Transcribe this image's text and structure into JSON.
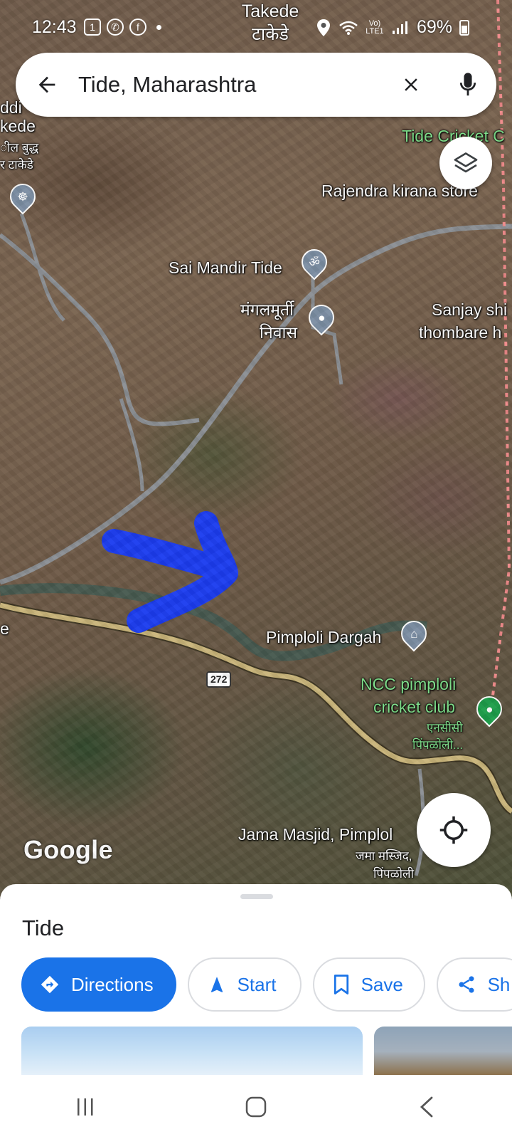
{
  "status_bar": {
    "time": "12:43",
    "notification_icons": [
      "calendar-icon",
      "whatsapp-icon",
      "facebook-icon",
      "more-dot-icon"
    ],
    "network_label": "Vo) LTE1",
    "battery_percent": "69%"
  },
  "search": {
    "query": "Tide, Maharashtra"
  },
  "map": {
    "labels": {
      "takede_en": "Takede",
      "takede_mr": "टाकेडे",
      "left_edge_1": "ddi",
      "left_edge_2": "kede",
      "left_edge_3": "ील बुद्ध",
      "left_edge_4": "र टाकेडे",
      "tide_cricket": "Tide Cricket C",
      "rajendra": "Rajendra kirana store",
      "sai_mandir": "Sai Mandir Tide",
      "mangalmurti_1": "मंगलमूर्ती",
      "mangalmurti_2": "निवास",
      "sanjay_1": "Sanjay shi",
      "sanjay_2": "thombare h",
      "left_edge_e": "e",
      "pimploli_dargah": "Pimploli Dargah",
      "road_number": "272",
      "ncc_1": "NCC pimploli",
      "ncc_2": "cricket club",
      "ncc_mr_1": "एनसीसी",
      "ncc_mr_2": "पिंपळोली...",
      "jama_masjid": "Jama Masjid, Pimplol",
      "jama_mr_1": "जमा मस्जिद,",
      "jama_mr_2": "पिंपळोली"
    },
    "attribution": "Google"
  },
  "place": {
    "title": "Tide"
  },
  "actions": {
    "directions": "Directions",
    "start": "Start",
    "save": "Save",
    "share": "Sh"
  },
  "colors": {
    "accent": "#1a73e8",
    "drawn_arrow": "#1c3cf0",
    "route_road": "#c9b57a",
    "boundary": "#f08a8a"
  }
}
